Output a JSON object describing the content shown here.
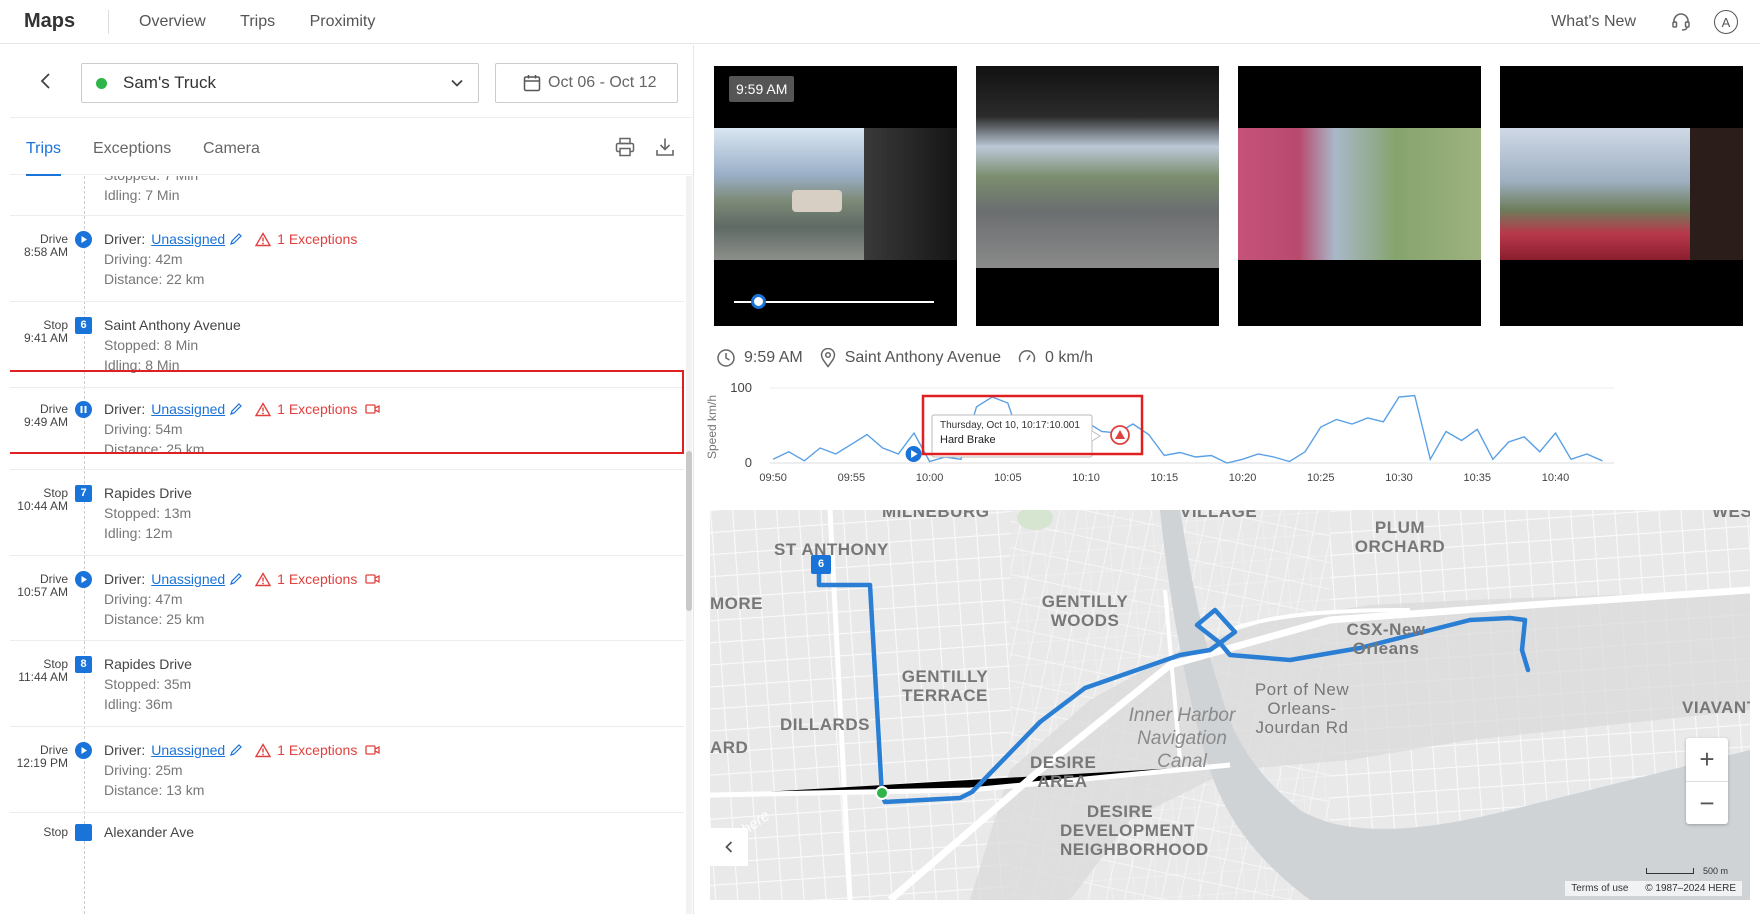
{
  "topbar": {
    "brand": "Maps",
    "nav": [
      "Overview",
      "Trips",
      "Proximity"
    ],
    "whats_new": "What's New",
    "avatar": "A"
  },
  "panel": {
    "vehicle": "Sam's Truck",
    "vehicle_status_color": "#2fb44a",
    "date_range": "Oct 06 - Oct 12",
    "tabs": [
      "Trips",
      "Exceptions",
      "Camera"
    ],
    "active_tab": "Trips"
  },
  "partial_top": {
    "line_cut": "Stopped: 7 Min",
    "idling": "Idling: 7 Min"
  },
  "entries": [
    {
      "type": "Drive",
      "time": "8:58 AM",
      "driver_label": "Driver:",
      "driver": "Unassigned",
      "exceptions": "1 Exceptions",
      "camera": false,
      "l2": "Driving: 42m",
      "l3": "Distance: 22 km"
    },
    {
      "type": "Stop",
      "time": "9:41 AM",
      "num": "6",
      "title": "Saint Anthony Avenue",
      "l2": "Stopped: 8 Min",
      "l3": "Idling: 8 Min"
    },
    {
      "type": "Drive",
      "time": "9:49 AM",
      "driver_label": "Driver:",
      "driver": "Unassigned",
      "exceptions": "1 Exceptions",
      "camera": true,
      "l2": "Driving: 54m",
      "l3": "Distance: 25 km",
      "selected": true
    },
    {
      "type": "Stop",
      "time": "10:44 AM",
      "num": "7",
      "title": "Rapides Drive",
      "l2": "Stopped: 13m",
      "l3": "Idling: 12m"
    },
    {
      "type": "Drive",
      "time": "10:57 AM",
      "driver_label": "Driver:",
      "driver": "Unassigned",
      "exceptions": "1 Exceptions",
      "camera": true,
      "l2": "Driving: 47m",
      "l3": "Distance: 25 km"
    },
    {
      "type": "Stop",
      "time": "11:44 AM",
      "num": "8",
      "title": "Rapides Drive",
      "l2": "Stopped: 35m",
      "l3": "Idling: 36m"
    },
    {
      "type": "Drive",
      "time": "12:19 PM",
      "driver_label": "Driver:",
      "driver": "Unassigned",
      "exceptions": "1 Exceptions",
      "camera": true,
      "l2": "Driving: 25m",
      "l3": "Distance: 13 km"
    },
    {
      "type": "Stop",
      "time": "",
      "num": "",
      "title": "Alexander Ave",
      "l2": "",
      "l3": ""
    }
  ],
  "media": {
    "timestamp": "9:59 AM",
    "playback_progress": 0.12
  },
  "info": {
    "time": "9:59 AM",
    "location": "Saint Anthony Avenue",
    "speed": "0 km/h"
  },
  "chart_data": {
    "type": "line",
    "ylabel": "Speed km/h",
    "ylim": [
      0,
      100
    ],
    "yticks": [
      "100",
      "0"
    ],
    "xticks": [
      "09:50",
      "09:55",
      "10:00",
      "10:05",
      "10:10",
      "10:15",
      "10:20",
      "10:25",
      "10:30",
      "10:35",
      "10:40"
    ],
    "series": [
      {
        "x": [
          "09:50",
          "09:51",
          "09:52",
          "09:53",
          "09:54",
          "09:55",
          "09:56",
          "09:57",
          "09:58",
          "09:59",
          "10:00",
          "10:01",
          "10:02",
          "10:03",
          "10:04",
          "10:05",
          "10:06",
          "10:07",
          "10:08",
          "10:09",
          "10:10",
          "10:11",
          "10:12",
          "10:13",
          "10:14",
          "10:15",
          "10:16",
          "10:17",
          "10:18",
          "10:19",
          "10:20",
          "10:21",
          "10:22",
          "10:23",
          "10:24",
          "10:25",
          "10:26",
          "10:27",
          "10:28",
          "10:29",
          "10:30",
          "10:31",
          "10:32",
          "10:33",
          "10:34",
          "10:35",
          "10:36",
          "10:37",
          "10:38",
          "10:39",
          "10:40",
          "10:41",
          "10:42",
          "10:43"
        ],
        "y": [
          5,
          15,
          3,
          20,
          12,
          25,
          38,
          20,
          12,
          40,
          2,
          8,
          5,
          75,
          88,
          80,
          18,
          40,
          35,
          30,
          55,
          42,
          40,
          52,
          38,
          10,
          14,
          8,
          10,
          0,
          5,
          12,
          8,
          2,
          15,
          48,
          58,
          52,
          60,
          55,
          88,
          90,
          5,
          42,
          30,
          45,
          5,
          28,
          35,
          15,
          40,
          5,
          12,
          3
        ]
      }
    ],
    "marker_time": "10:00",
    "tooltip": {
      "title": "Thursday, Oct 10, 10:17:10.001",
      "body": "Hard Brake"
    }
  },
  "map": {
    "labels": [
      "MILNEBURG",
      "VILLAGE",
      "PLUM ORCHARD",
      "WES",
      "ST ANTHONY",
      "GENTILLY WOODS",
      "CSX-New Orleans",
      "MORE",
      "GENTILLY TERRACE",
      "Port of New Orleans-Jourdan Rd",
      "VIAVANT",
      "DILLARDS",
      "ARD",
      "DESIRE AREA",
      "DESIRE DEVELOPMENT NEIGHBORHOOD"
    ],
    "water_label": "Inner Harbor Navigation Canal",
    "watermark": "here",
    "stop_marker": "6",
    "scale": "500 m",
    "terms": "Terms of use",
    "copyright": "© 1987–2024 HERE",
    "zoom_in": "+",
    "zoom_out": "−",
    "route_color": "#2a7fd4"
  }
}
